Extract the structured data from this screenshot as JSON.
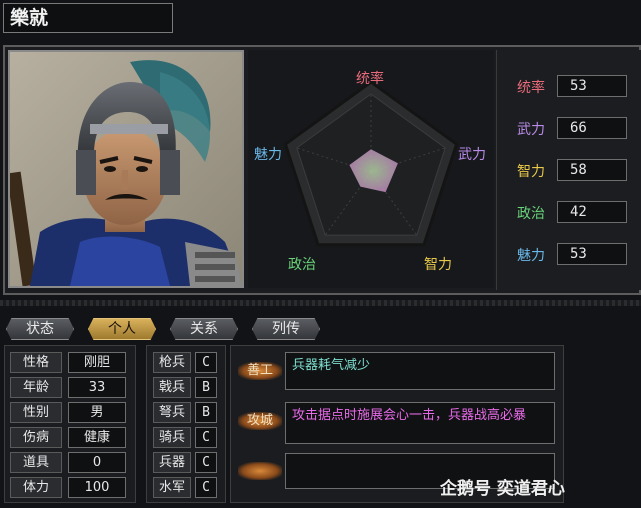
{
  "officer": {
    "name": "樂就"
  },
  "radar": {
    "labels": {
      "lead": "统率",
      "war": "武力",
      "intel": "智力",
      "pol": "政治",
      "chr": "魅力"
    },
    "values": {
      "lead": 53,
      "war": 66,
      "intel": 58,
      "pol": 42,
      "chr": 53
    },
    "colors": {
      "lead": "#e86b7a",
      "war": "#b98ae8",
      "intel": "#e8c84a",
      "pol": "#6ad27a",
      "chr": "#6ab8e8"
    }
  },
  "stats": [
    {
      "label": "统率",
      "value": "53",
      "color": "#e86b7a"
    },
    {
      "label": "武力",
      "value": "66",
      "color": "#b98ae8"
    },
    {
      "label": "智力",
      "value": "58",
      "color": "#e8c84a"
    },
    {
      "label": "政治",
      "value": "42",
      "color": "#6ad27a"
    },
    {
      "label": "魅力",
      "value": "53",
      "color": "#6ab8e8"
    }
  ],
  "tabs": [
    "状态",
    "个人",
    "关系",
    "列传"
  ],
  "active_tab": 1,
  "attributes": [
    {
      "label": "性格",
      "value": "刚胆"
    },
    {
      "label": "年龄",
      "value": "33"
    },
    {
      "label": "性别",
      "value": "男"
    },
    {
      "label": "伤病",
      "value": "健康"
    },
    {
      "label": "道具",
      "value": "0"
    },
    {
      "label": "体力",
      "value": "100"
    }
  ],
  "troops": [
    {
      "label": "枪兵",
      "value": "C"
    },
    {
      "label": "戟兵",
      "value": "B"
    },
    {
      "label": "弩兵",
      "value": "B"
    },
    {
      "label": "骑兵",
      "value": "C"
    },
    {
      "label": "兵器",
      "value": "C"
    },
    {
      "label": "水军",
      "value": "C"
    }
  ],
  "skills": [
    {
      "name": "善工",
      "desc": "兵器耗气减少",
      "color": "#7ee0d0"
    },
    {
      "name": "攻城",
      "desc": "攻击据点时施展会心一击，兵器战高必暴",
      "color": "#e86ae8"
    },
    {
      "name": "",
      "desc": "",
      "color": "#e8e8e8"
    }
  ],
  "watermark": "企鹅号 奕道君心"
}
